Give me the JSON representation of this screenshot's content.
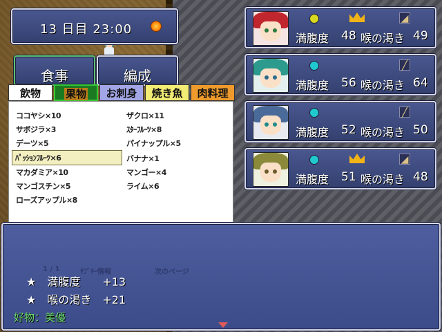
{
  "hud": {
    "day_time": "13 日目 23:00",
    "time_icon": "sun-icon",
    "time_icon_color": "#ff8a00"
  },
  "commands": {
    "eat": "食事",
    "formation": "編成"
  },
  "categories": [
    {
      "label": "飲物",
      "color": "#ffffff"
    },
    {
      "label": "果物",
      "color": "#1b7a21"
    },
    {
      "label": "お刺身",
      "color": "#a3a6e6"
    },
    {
      "label": "焼き魚",
      "color": "#f2eb74"
    },
    {
      "label": "肉料理",
      "color": "#ee9a2c"
    }
  ],
  "items": [
    "ココヤシ×10",
    "ザクロ×11",
    "サボジラ×3",
    "ｽﾀｰﾌﾙｰﾂ×8",
    "デーツ×5",
    "パイナップル×5",
    "ﾊﾟｯｼｮﾝﾌﾙｰﾂ×6",
    "バナナ×1",
    "マカダミア×10",
    "マンゴー×4",
    "マンゴスチン×5",
    "ライム×6",
    "ローズアップル×8"
  ],
  "selected_item": "ﾊﾟｯｼｮﾝﾌﾙｰﾂ×6",
  "party": [
    {
      "fullness_label": "満腹度",
      "fullness": "48",
      "thirst_label": "喉の渇き",
      "thirst": "49",
      "gem_color": "#d8d820",
      "leader": true,
      "tool_icon": "boot-icon"
    },
    {
      "fullness_label": "満腹度",
      "fullness": "56",
      "thirst_label": "喉の渇き",
      "thirst": "64",
      "gem_color": "#20c8d0",
      "leader": false,
      "tool_icon": "spear-icon"
    },
    {
      "fullness_label": "満腹度",
      "fullness": "52",
      "thirst_label": "喉の渇き",
      "thirst": "50",
      "gem_color": "#20c8d0",
      "leader": false,
      "tool_icon": "spear-icon"
    },
    {
      "fullness_label": "満腹度",
      "fullness": "51",
      "thirst_label": "喉の渇き",
      "thirst": "48",
      "gem_color": "#20c8d0",
      "leader": true,
      "tool_icon": "boot-icon"
    }
  ],
  "info": {
    "page_indicator": "1 / 1",
    "detail_label": "ｻﾌﾞｷｰ情報",
    "next_page": "次のページ",
    "effect1": "★　満腹度　　+13",
    "effect2": "★　喉の渇き　+21",
    "favorite": "好物：美優"
  }
}
